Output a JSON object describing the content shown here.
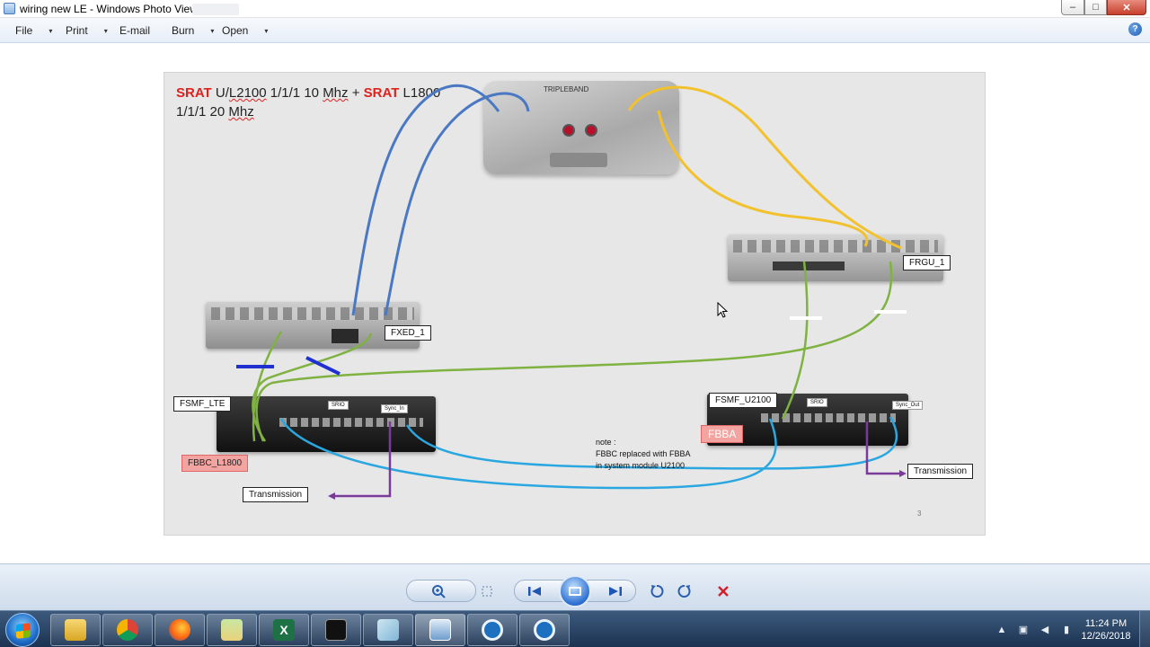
{
  "window": {
    "title": "wiring new LE - Windows Photo Viewer",
    "min_symbol": "–",
    "max_symbol": "□",
    "close_symbol": "✕"
  },
  "menu": {
    "items": [
      {
        "label": "File"
      },
      {
        "label": "Print"
      },
      {
        "label": "E-mail"
      },
      {
        "label": "Burn"
      },
      {
        "label": "Open"
      }
    ],
    "caret": "▾",
    "help": "?"
  },
  "slide": {
    "title_srat_1": "SRAT",
    "title_part_a": " U/",
    "title_squig_1": "L2100",
    "title_part_b": " 1/1/1 10 ",
    "title_squig_2": "Mhz",
    "title_part_c": " + ",
    "title_srat_2": "SRAT",
    "title_part_d": " L1800",
    "title_line2": "1/1/1 20 ",
    "title_squig_3": "Mhz",
    "labels": {
      "tripleband": "TRIPLEBAND",
      "fxed": "FXED_1",
      "frgu": "FRGU_1",
      "fsmf_lte": "FSMF_LTE",
      "fsmf_u2100": "FSMF_U2100",
      "fbbc": "FBBC_L1800",
      "fbba": "FBBA",
      "transmission_left": "Transmission",
      "transmission_right": "Transmission",
      "srio_left": "SRIO",
      "srio_right": "SRIO",
      "sync_in": "Sync_In",
      "sync_out": "Sync_Out"
    },
    "note_lines": [
      "note :",
      "FBBC replaced with FBBA",
      "in system module U2100"
    ],
    "page_number": "3",
    "wire_colors": {
      "rf_blue": "#4a78c2",
      "rf_yellow": "#f2c12e",
      "optical_green": "#7fb241",
      "sync_cyan": "#2aa7e0",
      "transmission_purple": "#7a3a9a"
    }
  },
  "controls": {
    "zoom_icon": "zoom-icon",
    "fit_icon": "actual-size-icon",
    "prev_icon": "previous-icon",
    "slideshow_icon": "slideshow-icon",
    "next_icon": "next-icon",
    "rotate_ccw_icon": "rotate-counterclockwise-icon",
    "rotate_cw_icon": "rotate-clockwise-icon",
    "delete_icon": "delete-icon"
  },
  "taskbar": {
    "apps": [
      "windows-explorer",
      "chrome",
      "firefox",
      "folder",
      "excel",
      "command-prompt",
      "notepad",
      "photo-viewer",
      "network-tool-1",
      "network-tool-2"
    ],
    "time": "11:24 PM",
    "date": "12/26/2018"
  }
}
